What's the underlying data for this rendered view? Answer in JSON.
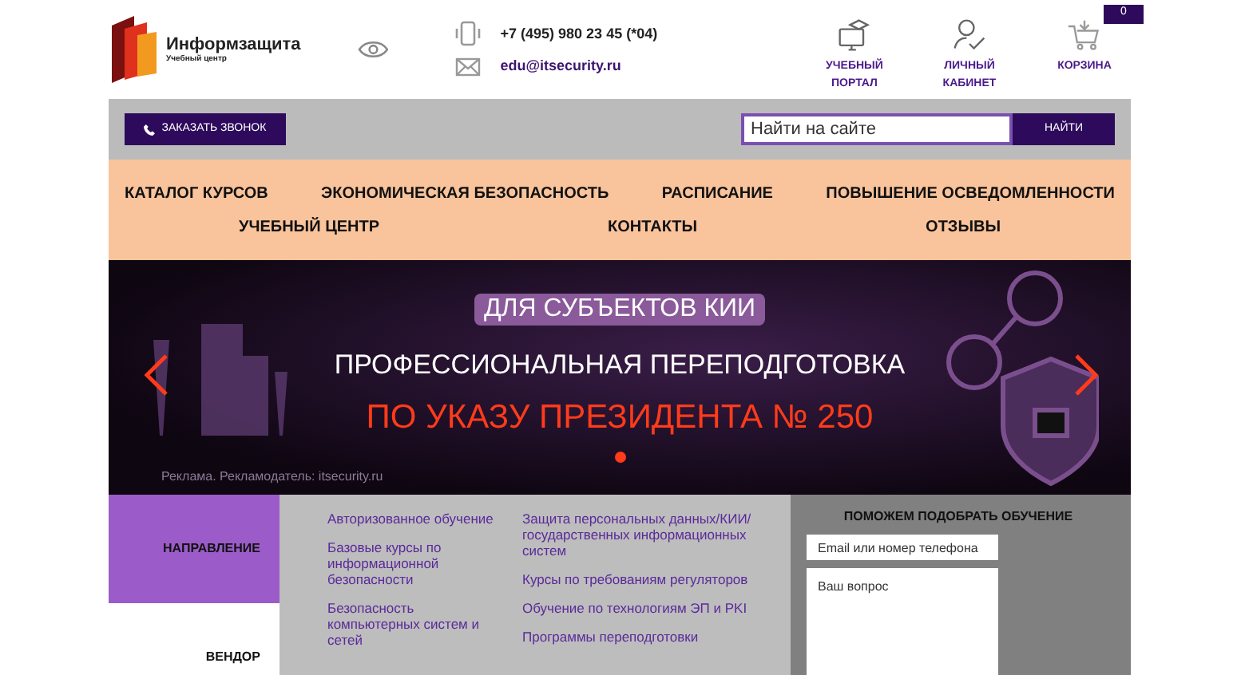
{
  "header": {
    "logo": {
      "name": "Информзащита",
      "tagline": "Учебный центр"
    },
    "phone": "+7 (495) 980 23 45 (*04)",
    "email": "edu@itsecurity.ru",
    "icons": [
      {
        "kind": "portal",
        "lines": [
          "УЧЕБНЫЙ",
          "ПОРТАЛ"
        ]
      },
      {
        "kind": "cabinet",
        "lines": [
          "ЛИЧНЫЙ",
          "КАБИНЕТ"
        ]
      },
      {
        "kind": "cart",
        "lines": [
          "КОРЗИНА"
        ],
        "badge": "0"
      }
    ]
  },
  "toolbar": {
    "callback": "ЗАКАЗАТЬ ЗВОНОК",
    "search": {
      "placeholder": "Найти на сайте",
      "button": "НАЙТИ"
    }
  },
  "nav": {
    "items": [
      "КАТАЛОГ КУРСОВ",
      "ЭКОНОМИЧЕСКАЯ БЕЗОПАСНОСТЬ",
      "РАСПИСАНИЕ",
      "ПОВЫШЕНИЕ ОСВЕДОМЛЕННОСТИ",
      "УЧЕБНЫЙ ЦЕНТР",
      "КОНТАКТЫ",
      "ОТЗЫВЫ"
    ]
  },
  "banner": {
    "tag": "ДЛЯ СУБЪЕКТОВ КИИ",
    "title": "ПРОФЕССИОНАЛЬНАЯ ПЕРЕПОДГОТОВКА",
    "highlight": "ПО УКАЗУ ПРЕЗИДЕНТА № 250",
    "ad": "Реклама. Рекламодатель: itsecurity.ru",
    "dots": [
      {
        "selected": true
      }
    ]
  },
  "filter_tabs": [
    {
      "label": "НАПРАВЛЕНИЕ",
      "selected": true
    },
    {
      "label": "ВЕНДОР",
      "selected": false
    }
  ],
  "course_links": [
    [
      "Авторизованное обучение",
      "Базовые курсы по информационной безопасности",
      "Безопасность компьютерных систем и сетей"
    ],
    [
      "Защита персональных данных/КИИ/ государственных информационных систем",
      "Курсы по требованиям регуляторов",
      "Обучение по технологиям ЭП и PKI",
      "Программы переподготовки"
    ]
  ],
  "help_form": {
    "title": "ПОМОЖЕМ ПОДОБРАТЬ ОБУЧЕНИЕ",
    "contact": {
      "placeholder": "Email или номер телефона"
    },
    "question": {
      "placeholder": "Ваш вопрос"
    }
  }
}
